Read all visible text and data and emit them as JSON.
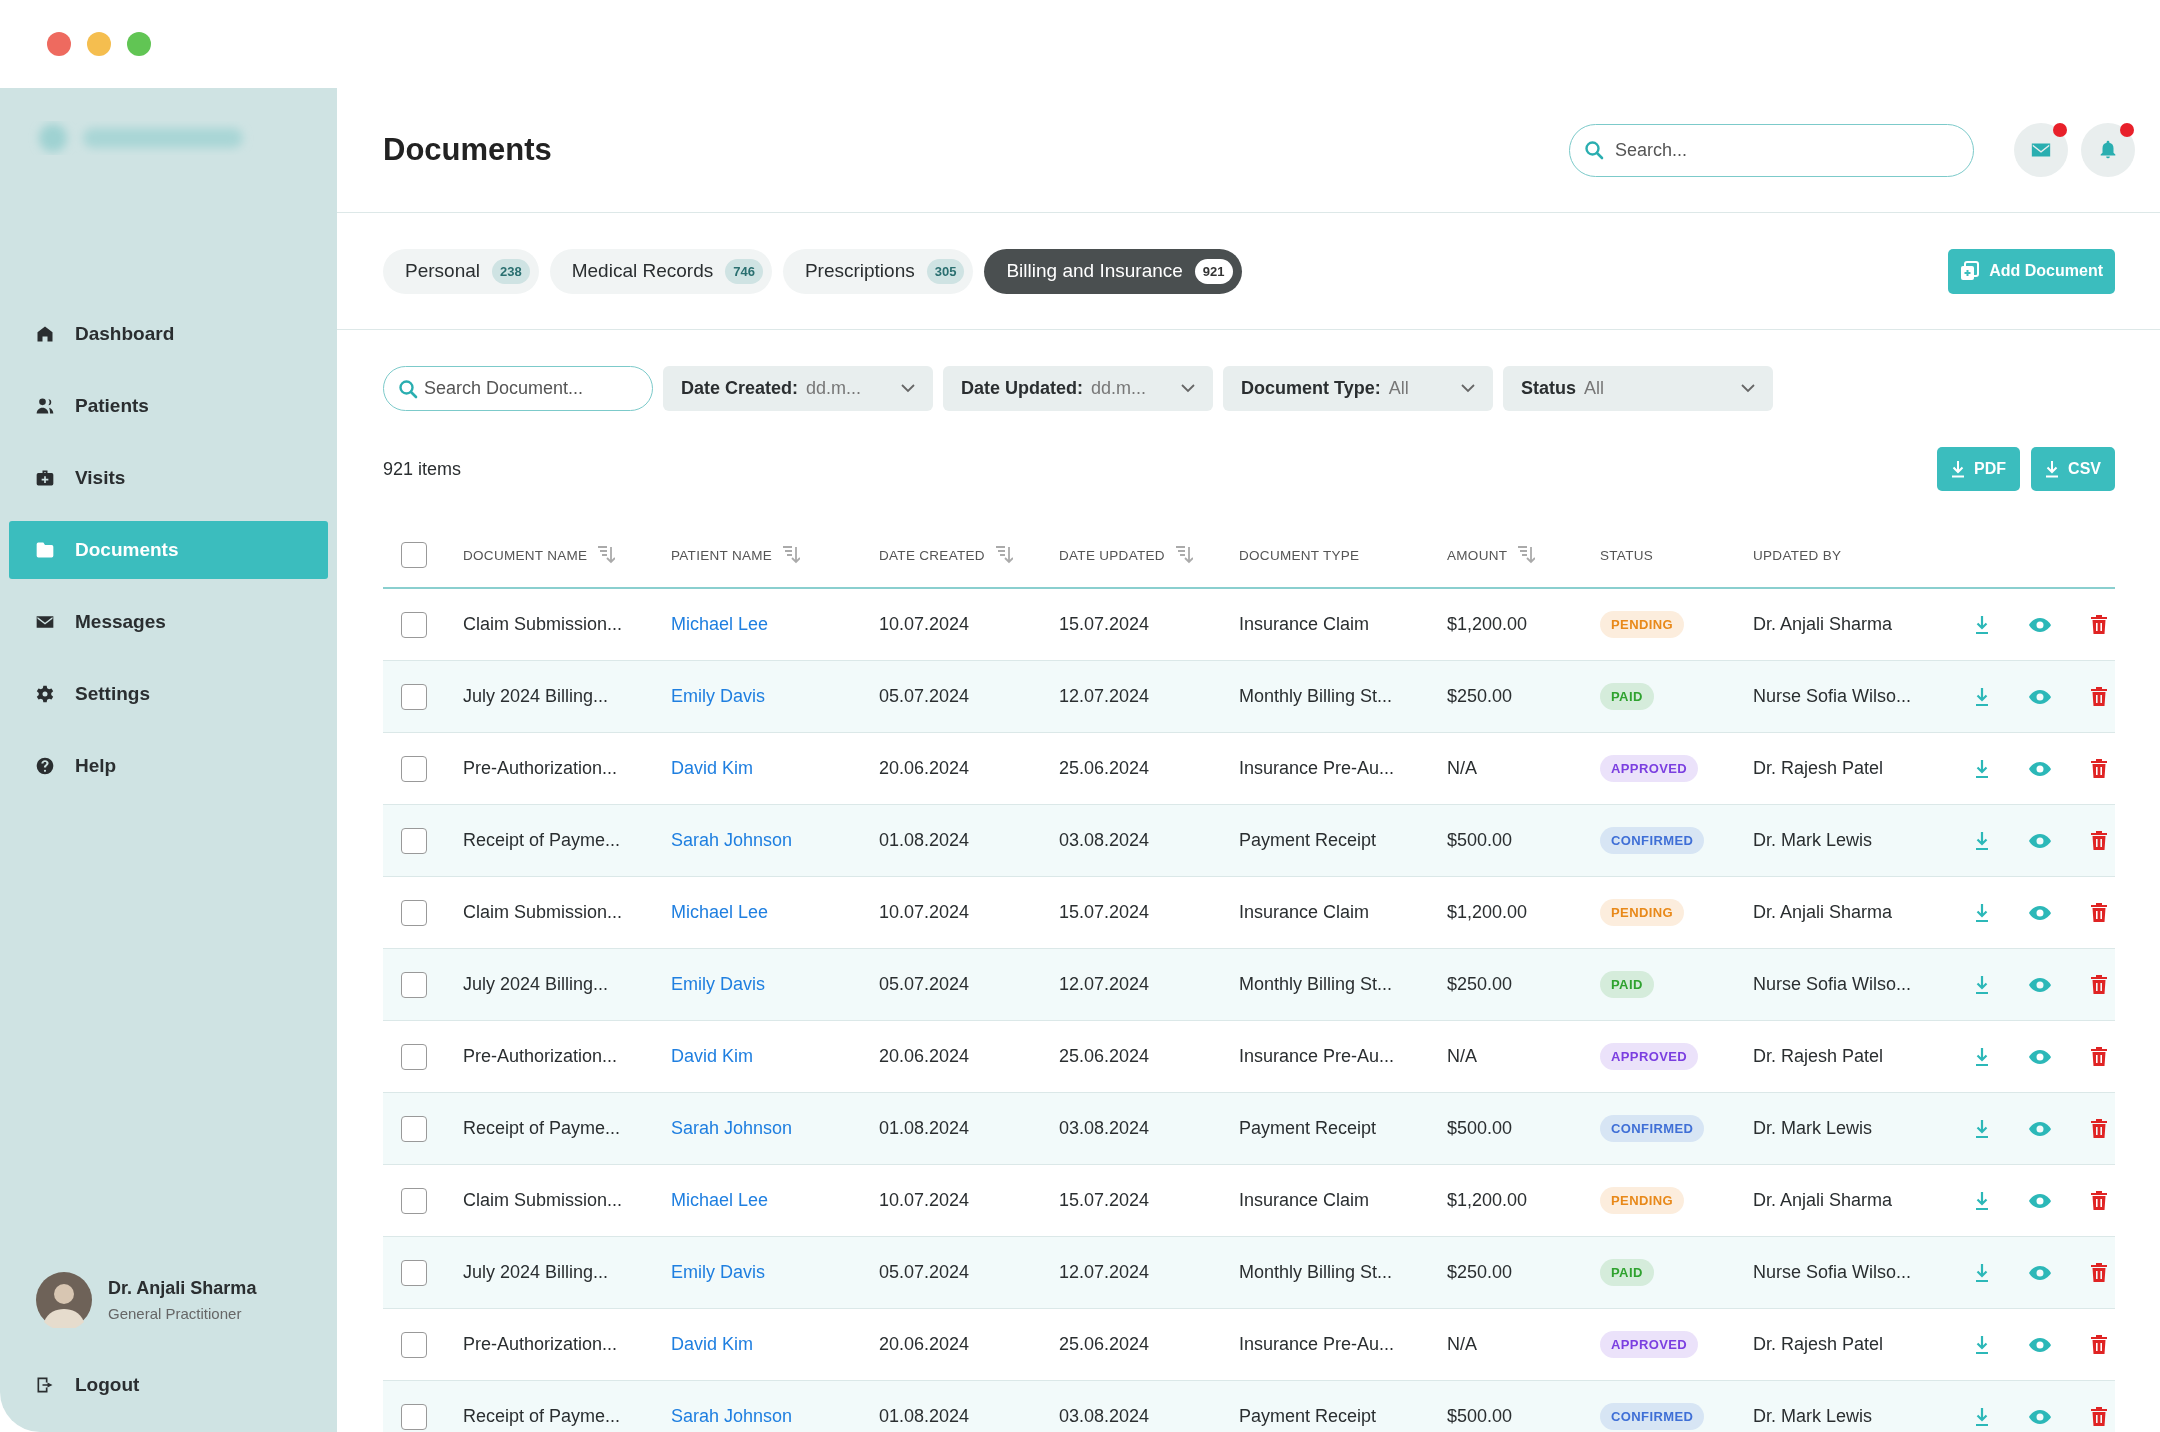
{
  "sidebar": {
    "items": [
      {
        "label": "Dashboard",
        "selected": false
      },
      {
        "label": "Patients",
        "selected": false
      },
      {
        "label": "Visits",
        "selected": false
      },
      {
        "label": "Documents",
        "selected": true
      },
      {
        "label": "Messages",
        "selected": false
      },
      {
        "label": "Settings",
        "selected": false
      },
      {
        "label": "Help",
        "selected": false
      }
    ],
    "user": {
      "name": "Dr. Anjali Sharma",
      "role": "General Practitioner"
    },
    "logout": "Logout"
  },
  "header": {
    "title": "Documents",
    "search": {
      "placeholder": "Search..."
    },
    "icons": [
      {
        "unread": true
      },
      {
        "unread": true
      }
    ]
  },
  "tabs": [
    {
      "label": "Personal",
      "count": "238",
      "selected": false
    },
    {
      "label": "Medical Records",
      "count": "746",
      "selected": false
    },
    {
      "label": "Prescriptions",
      "count": "305",
      "selected": false
    },
    {
      "label": "Billing and Insurance",
      "count": "921",
      "selected": true
    }
  ],
  "add_button": "Add Document",
  "filters": [
    {
      "kind": "search",
      "placeholder": "Search Document..."
    },
    {
      "kind": "select",
      "label": "Date Created:",
      "value": "dd.m..."
    },
    {
      "kind": "select",
      "label": "Date Updated:",
      "value": "dd.m..."
    },
    {
      "kind": "select",
      "label": "Document Type:",
      "value": "All"
    },
    {
      "kind": "select",
      "label": "Status",
      "value": "All"
    }
  ],
  "item_count": "921 items",
  "export_buttons": [
    "PDF",
    "CSV"
  ],
  "table": {
    "select_all_checked": false,
    "columns": [
      {
        "label": "DOCUMENT NAME",
        "sortable": true
      },
      {
        "label": "PATIENT NAME",
        "sortable": true
      },
      {
        "label": "DATE CREATED",
        "sortable": true
      },
      {
        "label": "DATE UPDATED",
        "sortable": true
      },
      {
        "label": "DOCUMENT TYPE",
        "sortable": false
      },
      {
        "label": "AMOUNT",
        "sortable": true
      },
      {
        "label": "STATUS",
        "sortable": false
      },
      {
        "label": "UPDATED BY",
        "sortable": false
      }
    ],
    "rows": [
      {
        "checked": false,
        "document": "Claim Submission...",
        "patient": "Michael Lee",
        "created": "10.07.2024",
        "updated": "15.07.2024",
        "type": "Insurance Claim",
        "amount": "$1,200.00",
        "status": "PENDING",
        "color": "#e8891a",
        "updated_by": "Dr. Anjali Sharma"
      },
      {
        "checked": false,
        "document": "July 2024 Billing...",
        "patient": "Emily Davis",
        "created": "05.07.2024",
        "updated": "12.07.2024",
        "type": "Monthly Billing St...",
        "amount": "$250.00",
        "status": "PAID",
        "color": "#2fa22f",
        "updated_by": "Nurse Sofia Wilso..."
      },
      {
        "checked": false,
        "document": "Pre-Authorization...",
        "patient": "David Kim",
        "created": "20.06.2024",
        "updated": "25.06.2024",
        "type": "Insurance Pre-Au...",
        "amount": "N/A",
        "status": "APPROVED",
        "color": "#7b3fe0",
        "updated_by": "Dr. Rajesh Patel"
      },
      {
        "checked": false,
        "document": "Receipt of Payme...",
        "patient": "Sarah Johnson",
        "created": "01.08.2024",
        "updated": "03.08.2024",
        "type": "Payment Receipt",
        "amount": "$500.00",
        "status": "CONFIRMED",
        "color": "#3f6fd6",
        "updated_by": "Dr. Mark Lewis"
      },
      {
        "checked": false,
        "document": "Claim Submission...",
        "patient": "Michael Lee",
        "created": "10.07.2024",
        "updated": "15.07.2024",
        "type": "Insurance Claim",
        "amount": "$1,200.00",
        "status": "PENDING",
        "color": "#e8891a",
        "updated_by": "Dr. Anjali Sharma"
      },
      {
        "checked": false,
        "document": "July 2024 Billing...",
        "patient": "Emily Davis",
        "created": "05.07.2024",
        "updated": "12.07.2024",
        "type": "Monthly Billing St...",
        "amount": "$250.00",
        "status": "PAID",
        "color": "#2fa22f",
        "updated_by": "Nurse Sofia Wilso..."
      },
      {
        "checked": false,
        "document": "Pre-Authorization...",
        "patient": "David Kim",
        "created": "20.06.2024",
        "updated": "25.06.2024",
        "type": "Insurance Pre-Au...",
        "amount": "N/A",
        "status": "APPROVED",
        "color": "#7b3fe0",
        "updated_by": "Dr. Rajesh Patel"
      },
      {
        "checked": false,
        "document": "Receipt of Payme...",
        "patient": "Sarah Johnson",
        "created": "01.08.2024",
        "updated": "03.08.2024",
        "type": "Payment Receipt",
        "amount": "$500.00",
        "status": "CONFIRMED",
        "color": "#3f6fd6",
        "updated_by": "Dr. Mark Lewis"
      },
      {
        "checked": false,
        "document": "Claim Submission...",
        "patient": "Michael Lee",
        "created": "10.07.2024",
        "updated": "15.07.2024",
        "type": "Insurance Claim",
        "amount": "$1,200.00",
        "status": "PENDING",
        "color": "#e8891a",
        "updated_by": "Dr. Anjali Sharma"
      },
      {
        "checked": false,
        "document": "July 2024 Billing...",
        "patient": "Emily Davis",
        "created": "05.07.2024",
        "updated": "12.07.2024",
        "type": "Monthly Billing St...",
        "amount": "$250.00",
        "status": "PAID",
        "color": "#2fa22f",
        "updated_by": "Nurse Sofia Wilso..."
      },
      {
        "checked": false,
        "document": "Pre-Authorization...",
        "patient": "David Kim",
        "created": "20.06.2024",
        "updated": "25.06.2024",
        "type": "Insurance Pre-Au...",
        "amount": "N/A",
        "status": "APPROVED",
        "color": "#7b3fe0",
        "updated_by": "Dr. Rajesh Patel"
      },
      {
        "checked": false,
        "document": "Receipt of Payme...",
        "patient": "Sarah Johnson",
        "created": "01.08.2024",
        "updated": "03.08.2024",
        "type": "Payment Receipt",
        "amount": "$500.00",
        "status": "CONFIRMED",
        "color": "#3f6fd6",
        "updated_by": "Dr. Mark Lewis"
      }
    ]
  }
}
